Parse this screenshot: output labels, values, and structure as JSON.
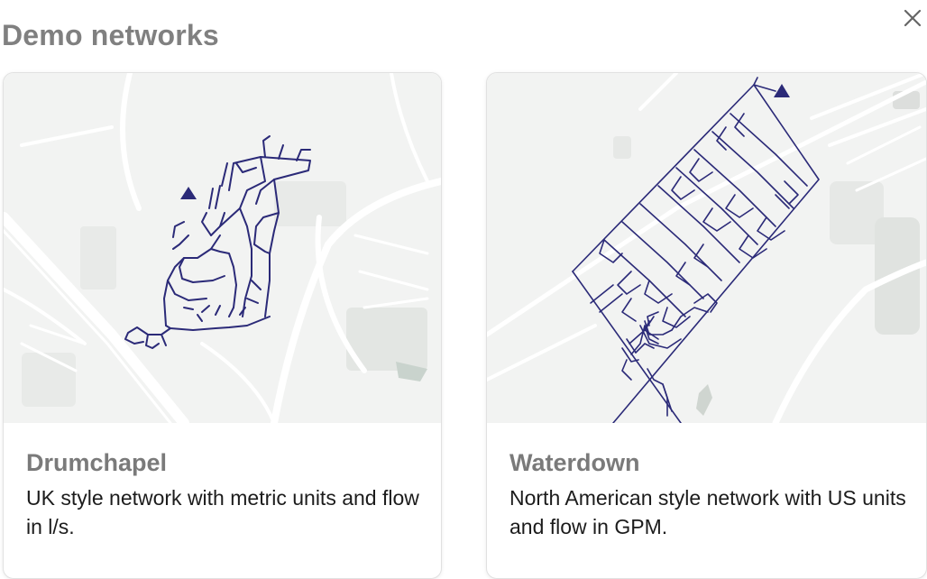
{
  "dialog": {
    "title": "Demo networks",
    "close_icon": "close-icon"
  },
  "networks": [
    {
      "name": "Drumchapel",
      "description": "UK style network with metric units and flow in l/s.",
      "map_icon": "map-thumbnail",
      "source_icon": "reservoir-triangle-icon"
    },
    {
      "name": "Waterdown",
      "description": "North American style network with US units and flow in GPM.",
      "map_icon": "map-thumbnail",
      "source_icon": "reservoir-triangle-icon"
    }
  ],
  "colors": {
    "network_line": "#2b2a78",
    "title_text": "#808080",
    "map_background": "#f2f3f2"
  }
}
